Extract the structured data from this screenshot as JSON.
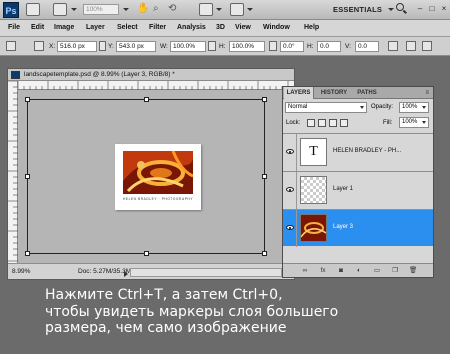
{
  "app": {
    "logo": "Ps",
    "zoom": "100%",
    "workspace": "ESSENTIALS",
    "window_controls": [
      "–",
      "□",
      "×"
    ]
  },
  "menu": [
    "File",
    "Edit",
    "Image",
    "Layer",
    "Select",
    "Filter",
    "Analysis",
    "3D",
    "View",
    "Window",
    "Help"
  ],
  "options": {
    "x_label": "X:",
    "x_value": "516.0 px",
    "y_label": "Y:",
    "y_value": "543.0 px",
    "w_label": "W:",
    "w_value": "100.0%",
    "h_label": "H:",
    "h_value": "100.0%",
    "angle_value": "0.0",
    "angle_unit": "°",
    "h_skew_label": "H:",
    "h_skew_value": "0.0",
    "v_skew_label": "V:",
    "v_skew_value": "0.0"
  },
  "document": {
    "title": "landscapetemplate.psd @ 8.99% (Layer 3, RGB/8) *",
    "status_zoom": "8.99%",
    "status_doc": "Doc: 5.27M/35.3M",
    "photo_caption": "HELEN BRADLEY · PHOTOGRAPHY"
  },
  "layers_panel": {
    "tabs": [
      "LAYERS",
      "HISTORY",
      "PATHS"
    ],
    "blend_mode": "Normal",
    "opacity_label": "Opacity:",
    "opacity_value": "100%",
    "lock_label": "Lock:",
    "fill_label": "Fill:",
    "fill_value": "100%",
    "layers": [
      {
        "name": "HELEN BRADLEY - PH...",
        "thumb": "T",
        "selected": false
      },
      {
        "name": "Layer 1",
        "selected": false
      },
      {
        "name": "Layer 3",
        "selected": true
      }
    ],
    "footer_icons": [
      "link-icon",
      "fx-icon",
      "mask-icon",
      "adjustment-icon",
      "folder-icon",
      "new-layer-icon",
      "trash-icon"
    ]
  },
  "caption": {
    "line1": "Нажмите Ctrl+T, а затем Ctrl+0,",
    "line2": "чтобы увидеть маркеры слоя большего",
    "line3": "размера, чем само изображение"
  },
  "colors": {
    "background": "#6b6b6b",
    "selected_layer": "#2b8ff0",
    "caption_text": "#ffffff"
  }
}
